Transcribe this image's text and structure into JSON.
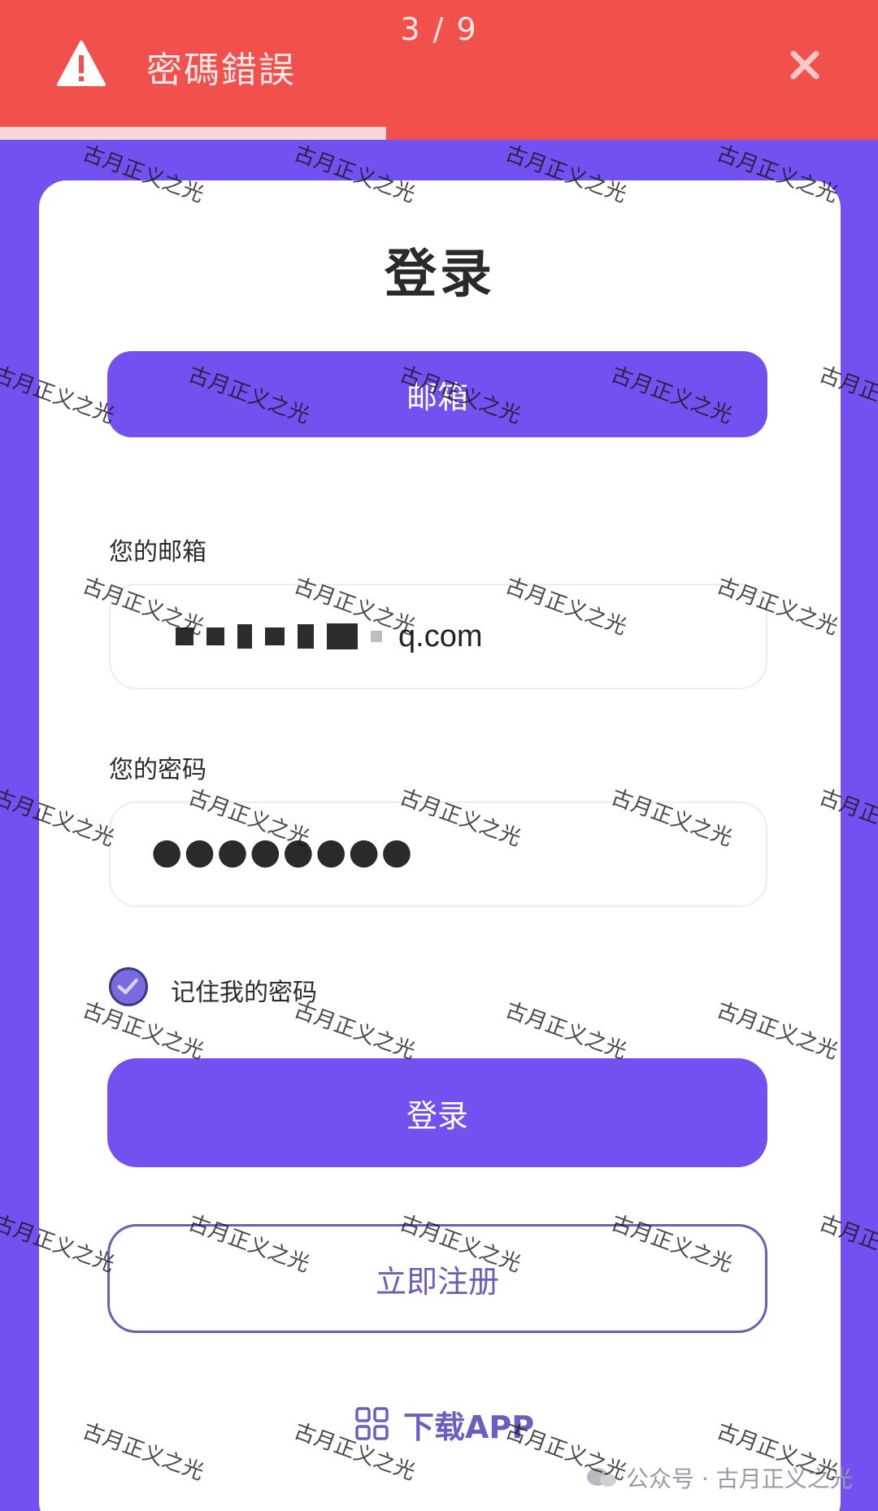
{
  "toast": {
    "title": "密碼錯誤",
    "counter": "3 / 9",
    "progress_fraction": 0.44,
    "background_color": "#f2504d",
    "icon": "warning-icon",
    "close_icon": "close-icon"
  },
  "card": {
    "title": "登录",
    "method_tab": "邮箱",
    "email_label": "您的邮箱",
    "email_value_visible_suffix": "q.com",
    "password_label": "您的密码",
    "password_dots": "●●●●●●●●",
    "remember_label": "记住我的密码",
    "remember_checked": true,
    "login_button": "登录",
    "register_button": "立即注册",
    "download_label": "下载APP",
    "download_icon": "grid-icon"
  },
  "credit": {
    "text": "公众号 · 古月正义之光"
  },
  "watermark": {
    "text": "古月正义之光"
  },
  "colors": {
    "accent": "#7351f0",
    "error": "#f2504d",
    "register_border": "#6b5fb5"
  }
}
